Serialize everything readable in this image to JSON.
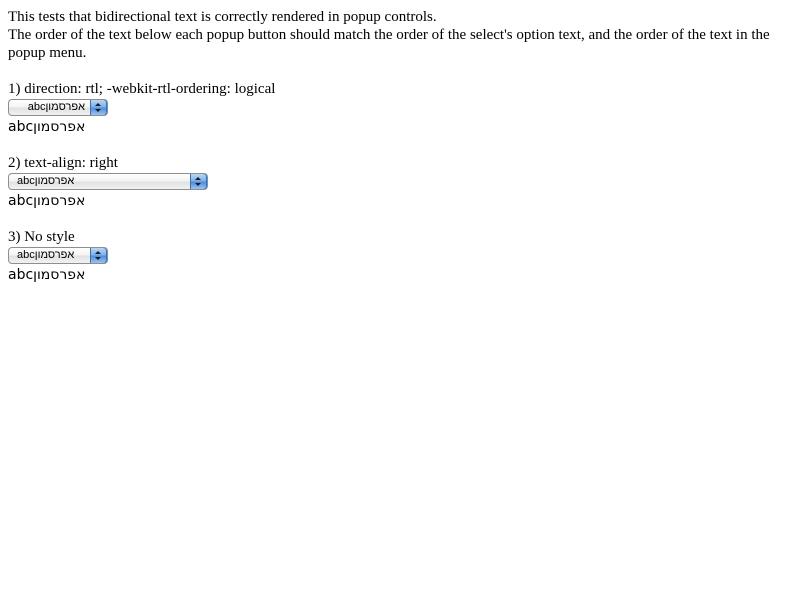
{
  "intro": {
    "line1": "This tests that bidirectional text is correctly rendered in popup controls.",
    "line2": "The order of the text below each popup button should match the order of the select's option text, and the order of the text in the popup menu."
  },
  "sections": [
    {
      "heading": "1) direction: rtl; -webkit-rtl-ordering: logical",
      "popup_value": "abcאפרסמון",
      "order_text": "abcאפרסמון"
    },
    {
      "heading": "2) text-align: right",
      "popup_value": "abcאפרסמון",
      "order_text": "abcאפרסמון"
    },
    {
      "heading": "3) No style",
      "popup_value": "abcאפרסמון",
      "order_text": "abcאפרסמון"
    }
  ]
}
